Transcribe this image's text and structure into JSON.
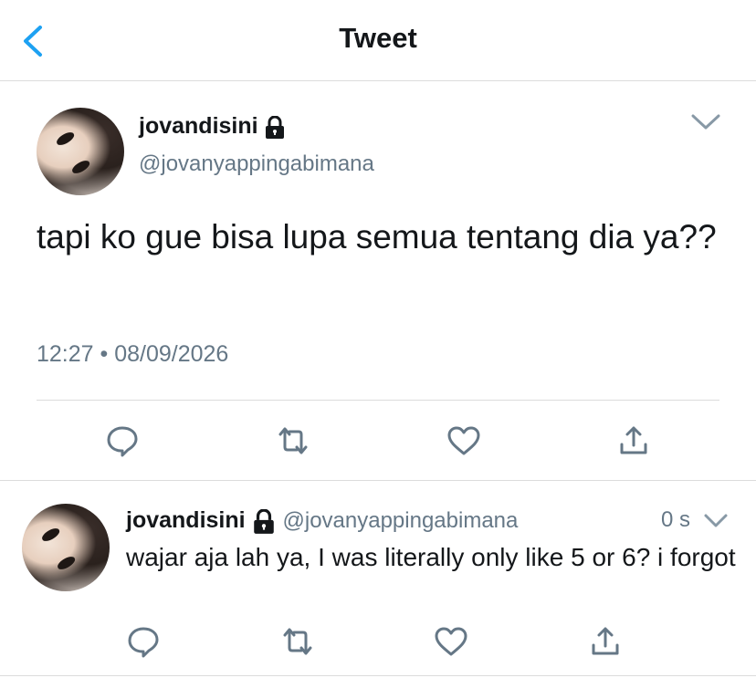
{
  "header": {
    "title": "Tweet"
  },
  "tweet": {
    "display_name": "jovandisini",
    "handle": "@jovanyappingabimana",
    "text": "tapi ko gue bisa lupa semua tentang dia ya??",
    "timestamp": "12:27 • 08/09/2026"
  },
  "reply": {
    "display_name": "jovandisini",
    "handle": "@jovanyappingabimana",
    "time": "0 s",
    "text": "wajar aja lah ya, I was literally only like 5 or 6? i forgot"
  },
  "colors": {
    "accent": "#1da1f2",
    "icon": "#657786",
    "divider": "#dcdcdc"
  },
  "icons": [
    "back-chevron-icon",
    "lock-icon",
    "chevron-down-icon",
    "reply-icon",
    "retweet-icon",
    "like-icon",
    "share-icon"
  ]
}
